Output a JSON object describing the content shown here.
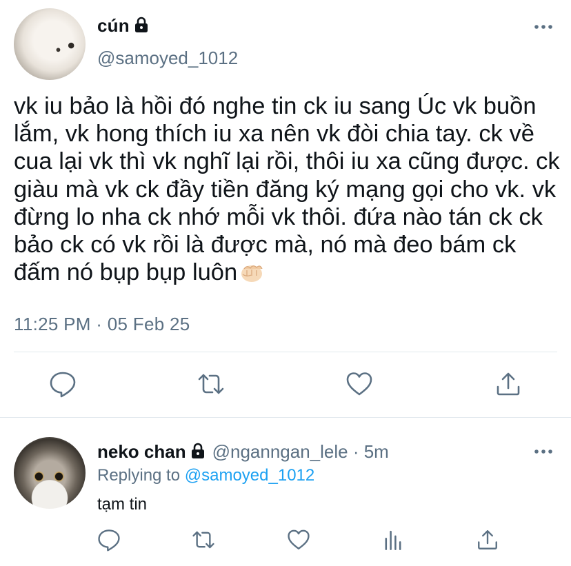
{
  "tweet": {
    "display_name": "cún",
    "handle": "@samoyed_1012",
    "text": "vk iu bảo là hồi đó nghe tin ck iu sang Úc vk buồn lắm, vk hong thích iu xa nên vk đòi chia tay. ck về cua lại vk thì vk nghĩ lại rồi, thôi iu xa cũng được. ck giàu mà vk ck đầy tiền đăng ký mạng gọi cho vk. vk đừng lo nha ck nhớ mỗi vk thôi. đứa nào tán ck ck bảo ck có vk rồi là được mà, nó mà đeo bám ck đấm nó bụp bụp luôn",
    "timestamp": "11:25 PM · 05 Feb 25",
    "emoji": "fist-emoji"
  },
  "reply": {
    "display_name": "neko chan",
    "handle": "@nganngan_lele · 5m",
    "replying_prefix": "Replying to",
    "replying_to": "@samoyed_1012",
    "text": "tạm tin"
  },
  "icons": {
    "lock": "lock-icon",
    "more": "more-horizontal-icon",
    "reply": "reply-icon",
    "retweet": "retweet-icon",
    "like": "heart-icon",
    "share": "share-icon",
    "analytics": "analytics-icon"
  },
  "colors": {
    "text": "#0f1419",
    "secondary": "#5b7083",
    "link": "#1da1f2",
    "divider": "#e1e8ed",
    "icon": "#5b7083"
  }
}
